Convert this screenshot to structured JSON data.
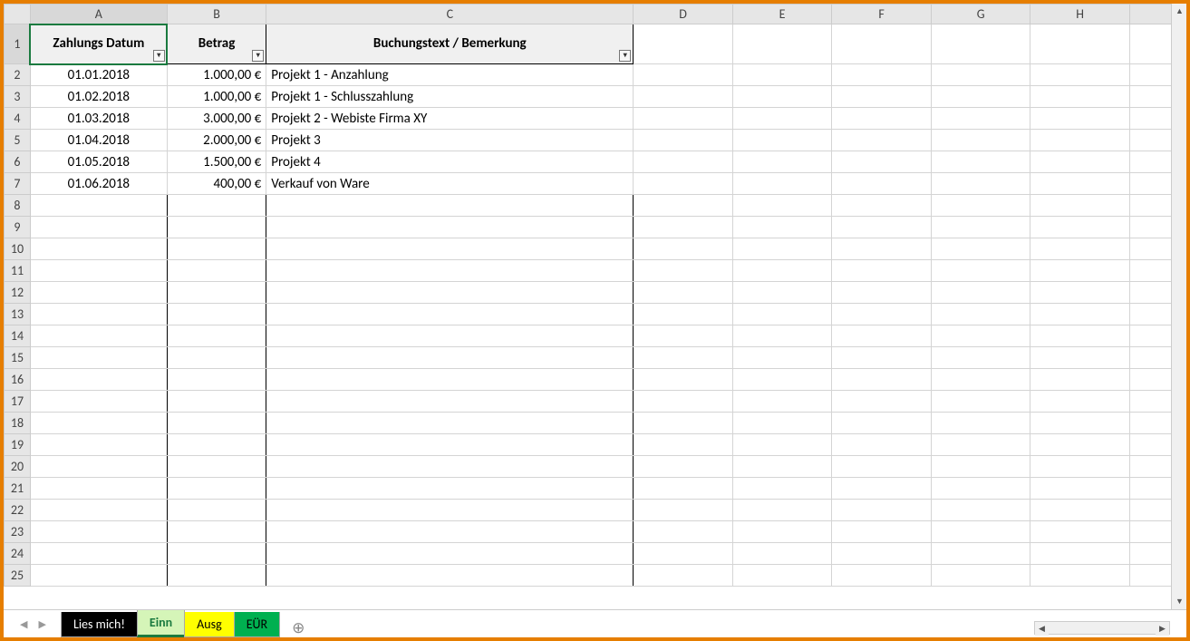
{
  "columns": [
    "A",
    "B",
    "C",
    "D",
    "E",
    "F",
    "G",
    "H"
  ],
  "rowCount": 25,
  "header": {
    "a": "Zahlungs Datum",
    "b": "Betrag",
    "c": "Buchungstext / Bemerkung"
  },
  "rows": [
    {
      "date": "01.01.2018",
      "amount": "1.000,00 €",
      "text": "Projekt 1 - Anzahlung"
    },
    {
      "date": "01.02.2018",
      "amount": "1.000,00 €",
      "text": "Projekt 1 - Schlusszahlung"
    },
    {
      "date": "01.03.2018",
      "amount": "3.000,00 €",
      "text": "Projekt 2 - Webiste Firma XY"
    },
    {
      "date": "01.04.2018",
      "amount": "2.000,00 €",
      "text": "Projekt 3"
    },
    {
      "date": "01.05.2018",
      "amount": "1.500,00 €",
      "text": "Projekt 4"
    },
    {
      "date": "01.06.2018",
      "amount": "400,00 €",
      "text": "Verkauf von Ware"
    }
  ],
  "tabs": {
    "t1": "Lies mich!",
    "t2": "Einn",
    "t3": "Ausg",
    "t4": "EÜR"
  },
  "selectedCell": "A1",
  "colWidths": {
    "row": 28,
    "A": 146,
    "B": 106,
    "C": 392,
    "D": 106,
    "E": 106,
    "F": 106,
    "G": 106,
    "H": 106,
    "rest": 60
  }
}
